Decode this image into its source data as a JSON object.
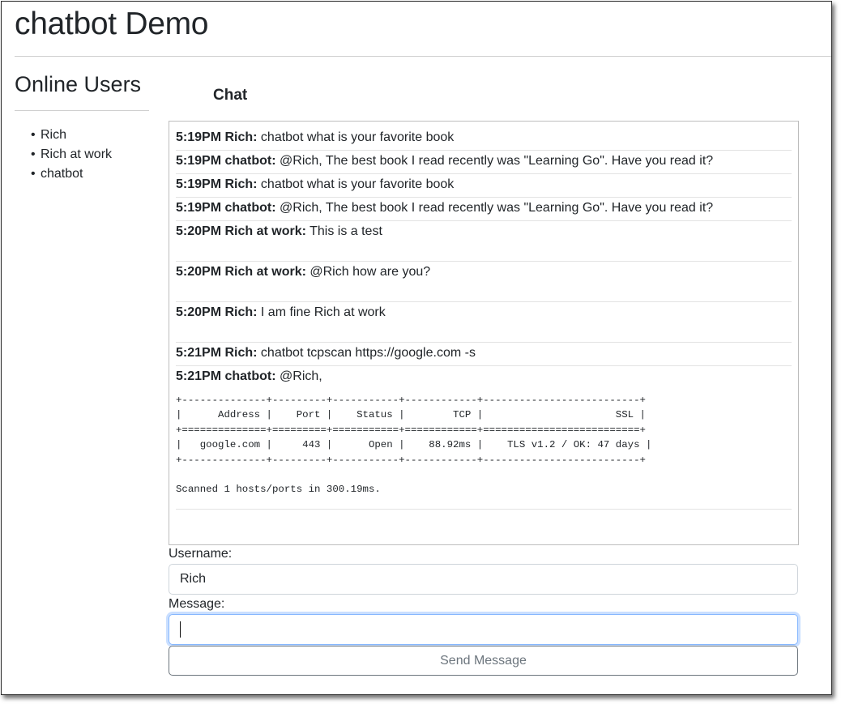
{
  "app": {
    "title": "chatbot Demo"
  },
  "users": {
    "heading": "Online Users",
    "list": [
      "Rich",
      "Rich at work",
      "chatbot"
    ]
  },
  "chat": {
    "heading": "Chat",
    "messages": [
      {
        "meta": "5:19PM Rich:",
        "text": " chatbot what is your favorite book"
      },
      {
        "meta": "5:19PM chatbot:",
        "text": " @Rich, The best book I read recently was \"Learning Go\". Have you read it?"
      },
      {
        "meta": "5:19PM Rich:",
        "text": " chatbot what is your favorite book"
      },
      {
        "meta": "5:19PM chatbot:",
        "text": " @Rich, The best book I read recently was \"Learning Go\". Have you read it?"
      },
      {
        "meta": "5:20PM Rich at work:",
        "text": " This is a test"
      },
      {
        "meta": "5:20PM Rich at work:",
        "text": " @Rich how are you?"
      },
      {
        "meta": "5:20PM Rich:",
        "text": " I am fine Rich at work"
      },
      {
        "meta": "5:21PM Rich:",
        "text": " chatbot tcpscan https://google.com -s"
      },
      {
        "meta": "5:21PM chatbot:",
        "text": " @Rich,"
      }
    ],
    "scan_output": "+--------------+---------+-----------+------------+--------------------------+\n|      Address |    Port |    Status |        TCP |                      SSL |\n+==============+=========+===========+============+==========================+\n|   google.com |     443 |      Open |    88.92ms |    TLS v1.2 / OK: 47 days |\n+--------------+---------+-----------+------------+--------------------------+\n\nScanned 1 hosts/ports in 300.19ms."
  },
  "form": {
    "username_label": "Username:",
    "username_value": "Rich",
    "message_label": "Message:",
    "message_value": "",
    "send_label": "Send Message"
  }
}
